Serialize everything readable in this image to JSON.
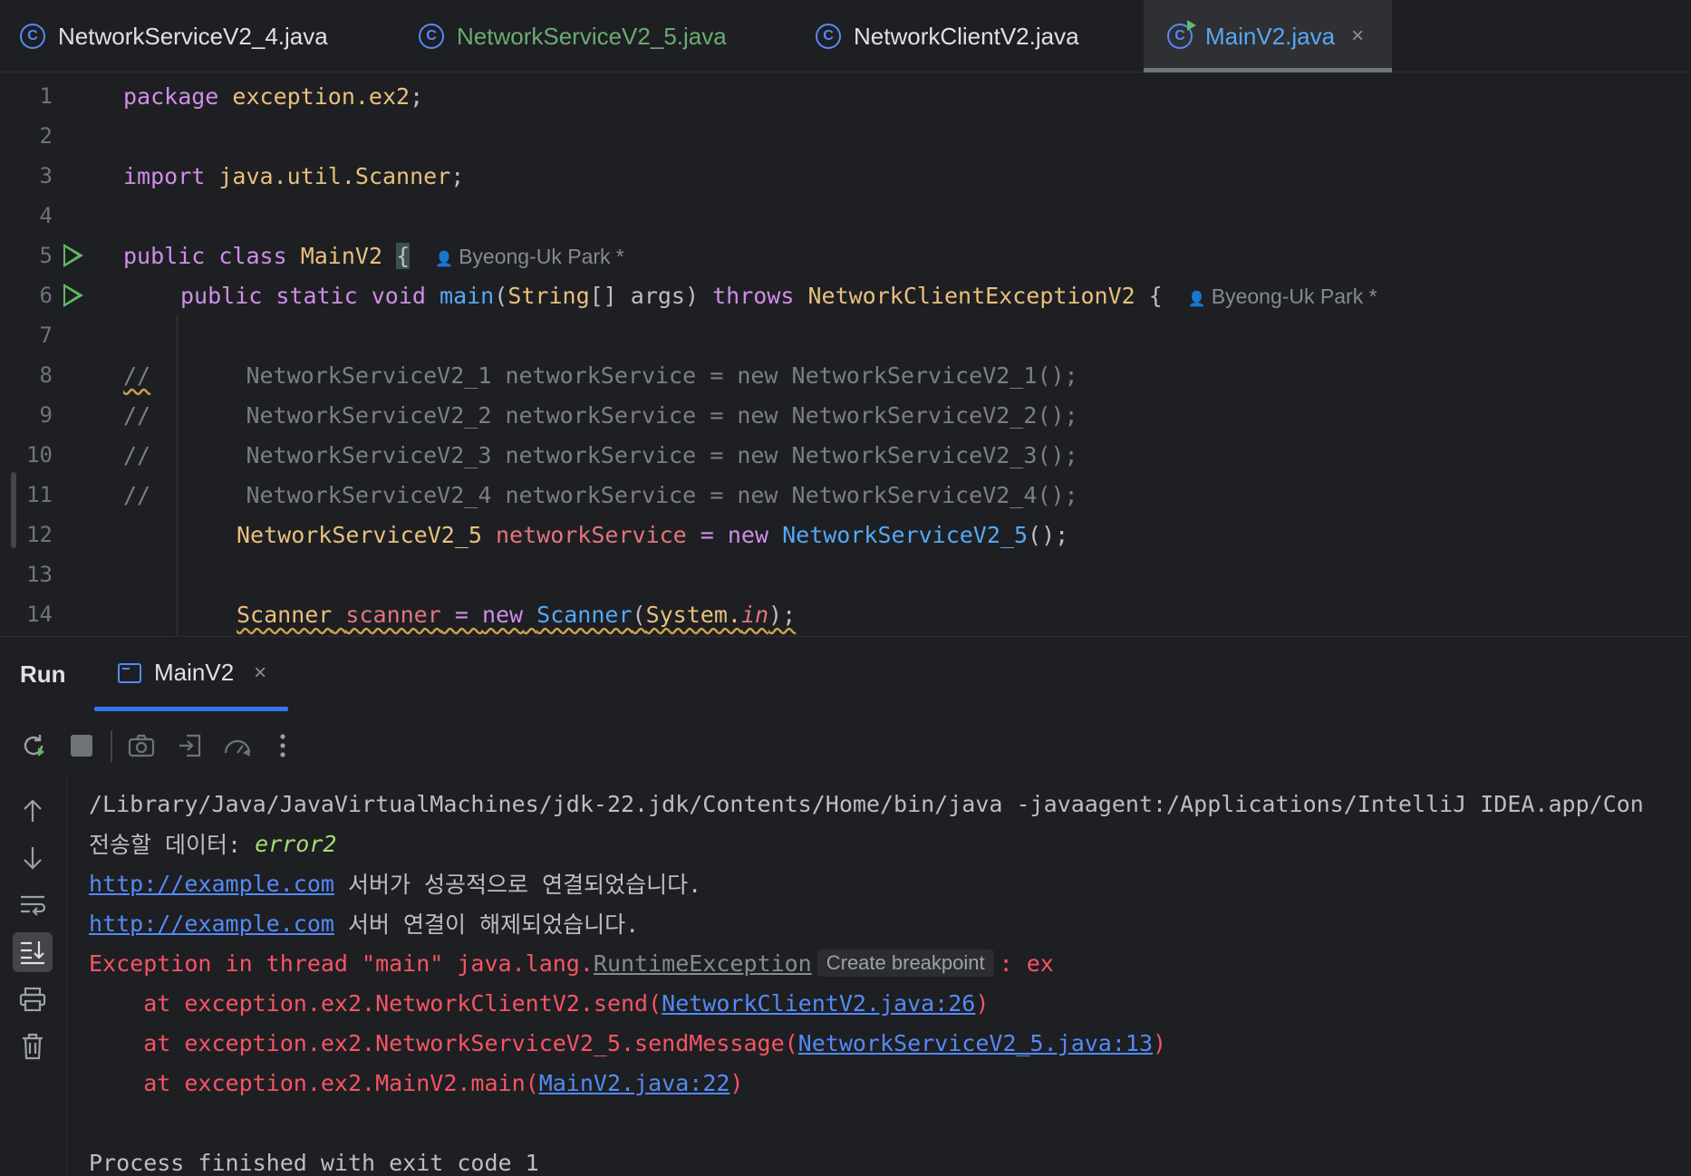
{
  "tabs": [
    {
      "label": "NetworkServiceV2_4.java",
      "color": "#dfe1e5",
      "active": false
    },
    {
      "label": "NetworkServiceV2_5.java",
      "color": "#6aab73",
      "active": false
    },
    {
      "label": "NetworkClientV2.java",
      "color": "#dfe1e5",
      "active": false
    },
    {
      "label": "MainV2.java",
      "color": "#56a8f5",
      "active": true
    }
  ],
  "editor": {
    "line_numbers": [
      "1",
      "2",
      "3",
      "4",
      "5",
      "6",
      "7",
      "8",
      "9",
      "10",
      "11",
      "12",
      "13",
      "14"
    ],
    "l1": {
      "kw": "package",
      "rest": "exception.ex2",
      "semi": ";"
    },
    "l3": {
      "kw": "import",
      "rest": "java.util.Scanner",
      "semi": ";"
    },
    "l5": {
      "kw1": "public",
      "kw2": "class",
      "name": "MainV2",
      "brace": "{",
      "author": "Byeong-Uk Park *"
    },
    "l6": {
      "kw1": "public",
      "kw2": "static",
      "kw3": "void",
      "fn": "main",
      "open": "(",
      "type": "String",
      "args": "[] args) ",
      "throws": "throws",
      "exc": "NetworkClientExceptionV2",
      "brace": " {",
      "author": "Byeong-Uk Park *"
    },
    "comments": [
      {
        "slashes": "//",
        "text": "       NetworkServiceV2_1 networkService = new NetworkServiceV2_1();"
      },
      {
        "slashes": "//",
        "text": "       NetworkServiceV2_2 networkService = new NetworkServiceV2_2();"
      },
      {
        "slashes": "//",
        "text": "       NetworkServiceV2_3 networkService = new NetworkServiceV2_3();"
      },
      {
        "slashes": "//",
        "text": "       NetworkServiceV2_4 networkService = new NetworkServiceV2_4();"
      }
    ],
    "l12": {
      "type": "NetworkServiceV2_5",
      "var": "networkService",
      "eq": " = ",
      "kw": "new",
      "ctor": "NetworkServiceV2_5",
      "tail": "();"
    },
    "l14": {
      "type": "Scanner",
      "var": "scanner",
      "eq": " = ",
      "kw": "new",
      "ctor": "Scanner",
      "open": "(",
      "sys": "System.",
      "in": "in",
      "tail": ");"
    }
  },
  "run": {
    "title": "Run",
    "tab_label": "MainV2",
    "close_glyph": "×"
  },
  "console": {
    "cmd": "/Library/Java/JavaVirtualMachines/jdk-22.jdk/Contents/Home/bin/java -javaagent:/Applications/IntelliJ IDEA.app/Con",
    "prompt": "전송할 데이터: ",
    "input": "error2",
    "l3_link": "http://example.com",
    "l3_text": " 서버가 성공적으로 연결되었습니다.",
    "l4_link": "http://example.com",
    "l4_text": " 서버 연결이 해제되었습니다.",
    "exc_prefix": "Exception in thread \"main\" java.lang.",
    "exc_class": "RuntimeException",
    "tooltip": "Create breakpoint",
    "exc_suffix": ": ex",
    "stack": [
      {
        "prefix": "    at exception.ex2.NetworkClientV2.send(",
        "link": "NetworkClientV2.java:26",
        "suffix": ")"
      },
      {
        "prefix": "    at exception.ex2.NetworkServiceV2_5.sendMessage(",
        "link": "NetworkServiceV2_5.java:13",
        "suffix": ")"
      },
      {
        "prefix": "    at exception.ex2.MainV2.main(",
        "link": "MainV2.java:22",
        "suffix": ")"
      }
    ],
    "finished": "Process finished with exit code 1"
  }
}
